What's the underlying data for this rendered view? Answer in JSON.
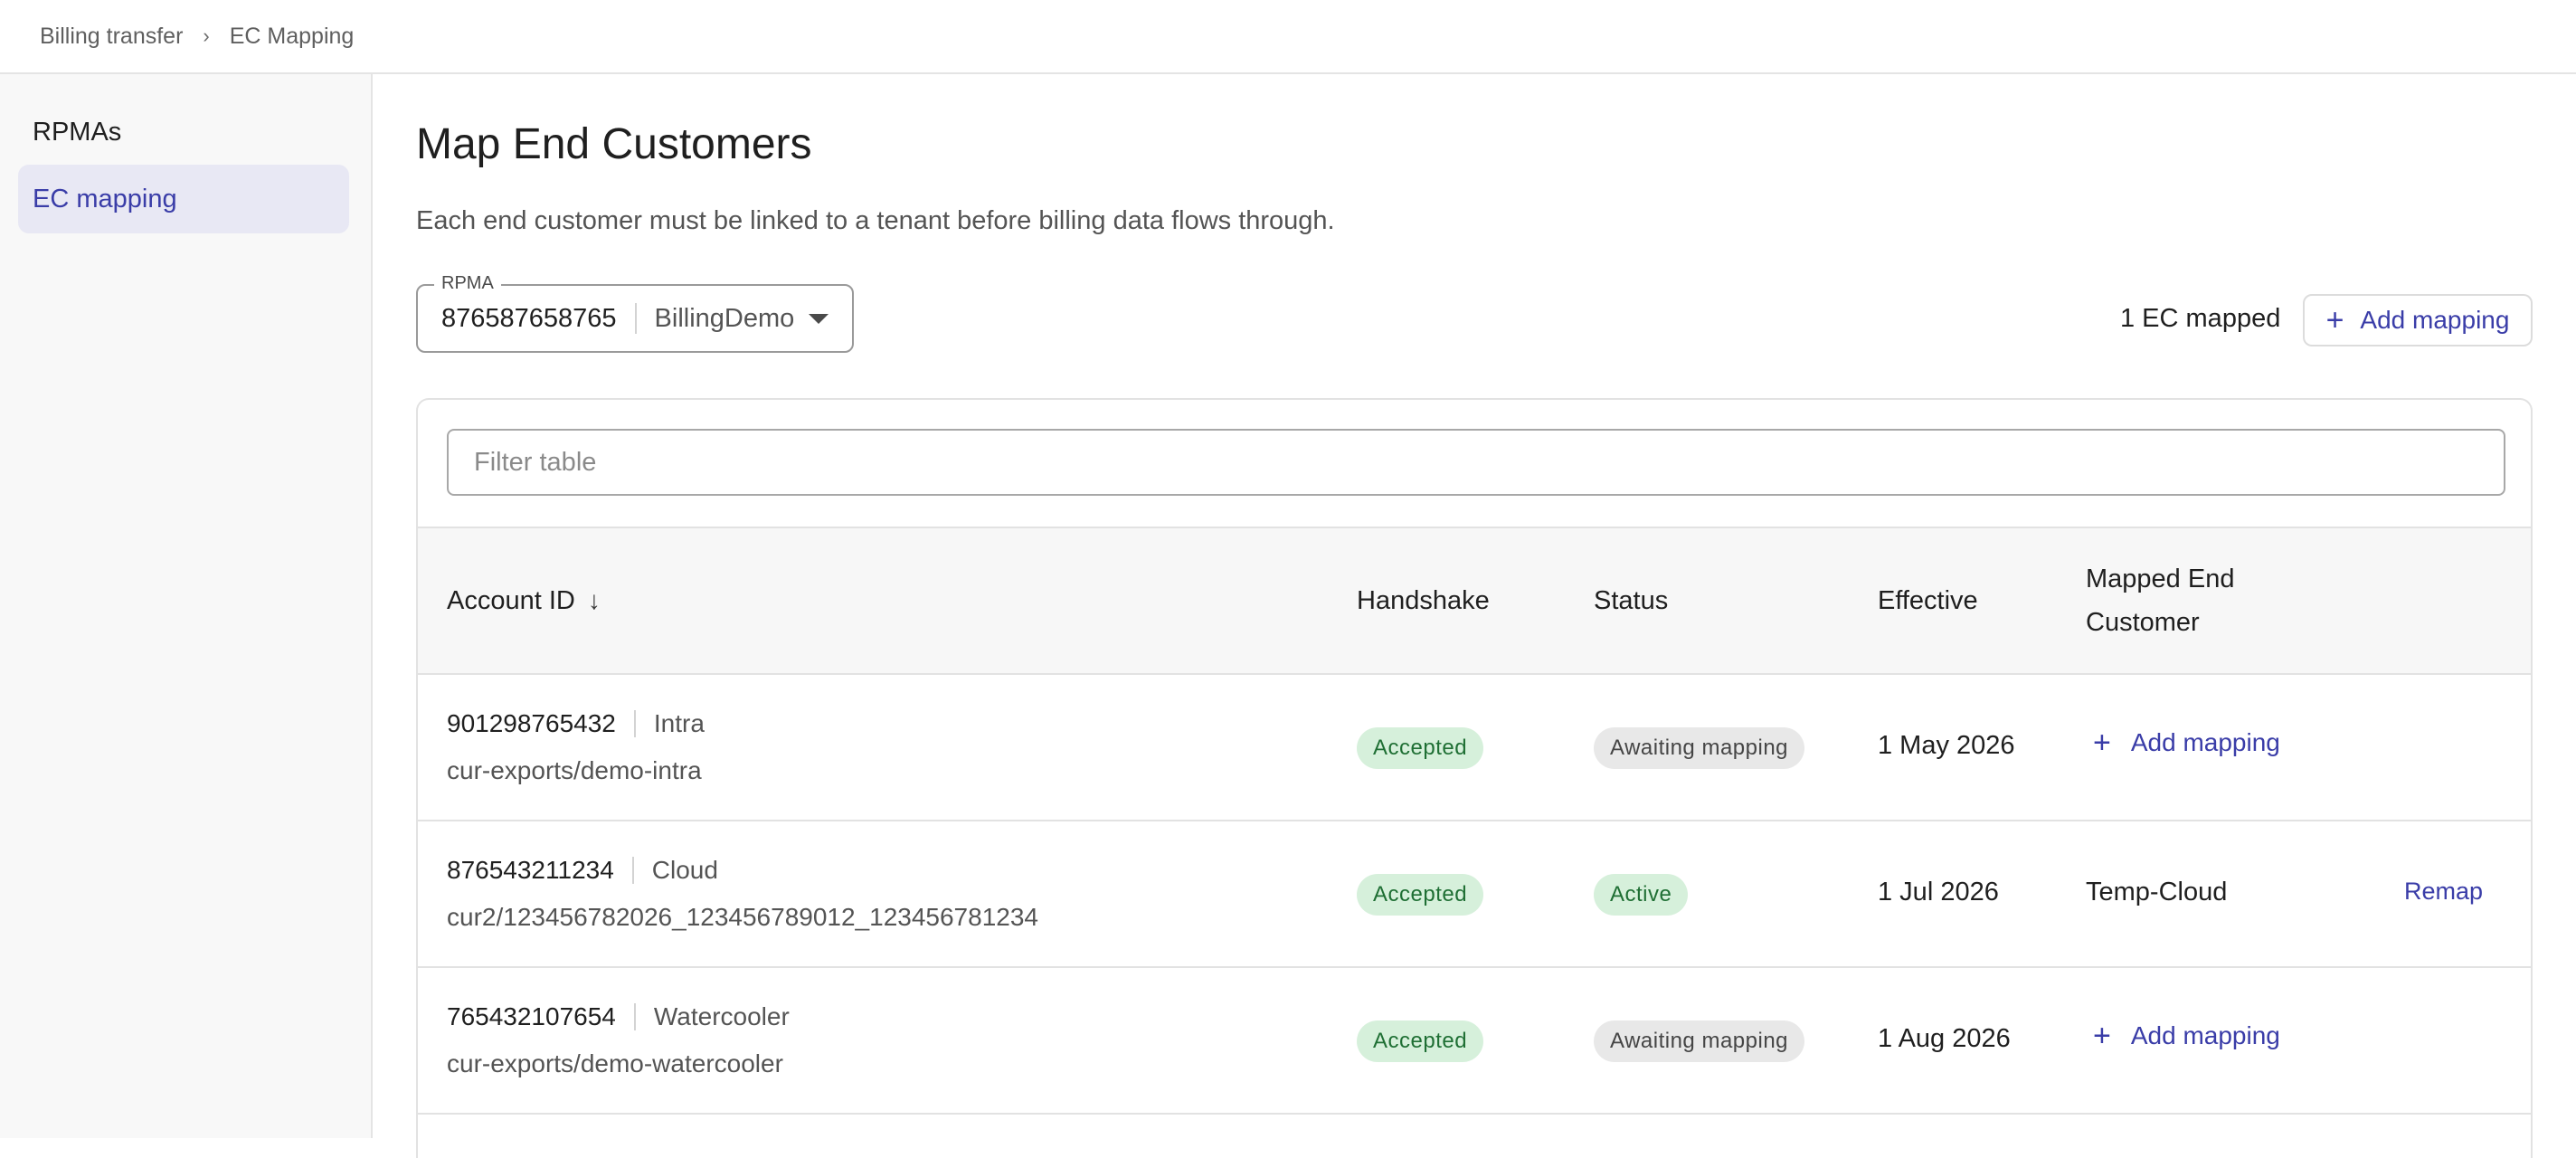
{
  "breadcrumb": {
    "items": [
      "Billing transfer",
      "EC Mapping"
    ],
    "separator": "›"
  },
  "sidebar": {
    "items": [
      {
        "label": "RPMAs",
        "active": false
      },
      {
        "label": "EC mapping",
        "active": true
      }
    ]
  },
  "page": {
    "title": "Map End Customers",
    "description": "Each end customer must be linked to a tenant before billing data flows through."
  },
  "rpma": {
    "legend": "RPMA",
    "id": "876587658765",
    "name": "BillingDemo"
  },
  "summary": {
    "mapped_count": "1 EC mapped",
    "add_mapping_label": "Add mapping"
  },
  "filter": {
    "placeholder": "Filter table",
    "value": ""
  },
  "table": {
    "headers": {
      "account_id": "Account ID",
      "handshake": "Handshake",
      "status": "Status",
      "effective": "Effective",
      "mapped_end_customer": "Mapped End Customer"
    },
    "sort": {
      "column": "account_id",
      "direction": "descending"
    },
    "rows": [
      {
        "account_id": "901298765432",
        "account_name": "Intra",
        "path": "cur-exports/demo-intra",
        "handshake": "Accepted",
        "status": "Awaiting mapping",
        "effective": "1 May 2026",
        "mapped": "",
        "action": "Add mapping"
      },
      {
        "account_id": "876543211234",
        "account_name": "Cloud",
        "path": "cur2/123456782026_123456789012_123456781234",
        "handshake": "Accepted",
        "status": "Active",
        "effective": "1 Jul 2026",
        "mapped": "Temp-Cloud",
        "action": "Remap"
      },
      {
        "account_id": "765432107654",
        "account_name": "Watercooler",
        "path": "cur-exports/demo-watercooler",
        "handshake": "Accepted",
        "status": "Awaiting mapping",
        "effective": "1 Aug 2026",
        "mapped": "",
        "action": "Add mapping"
      }
    ]
  },
  "colors": {
    "accent": "#3a3da8",
    "success_bg": "#d6f0db",
    "success_text": "#1f6f34",
    "neutral_bg": "#e8e8e8",
    "active_nav_bg": "#e8e8f4"
  },
  "icons": {
    "breadcrumb_separator": "chevron-right-icon",
    "select": "caret-down-icon",
    "add": "plus-icon",
    "sort": "arrow-down-icon"
  }
}
